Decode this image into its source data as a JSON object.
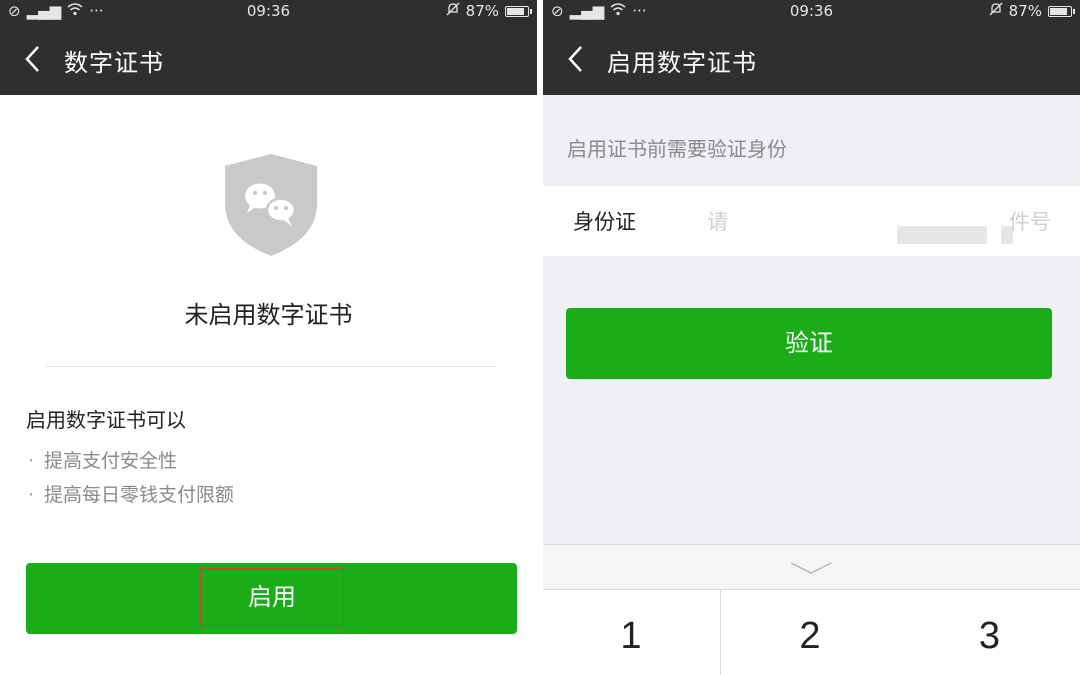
{
  "status_bar": {
    "time": "09:36",
    "battery": "87%",
    "battery_level": 0.87,
    "left_icons": [
      "no-sim-icon",
      "signal-icon",
      "wifi-icon",
      "more-dots-icon"
    ],
    "right_icons": [
      "mute-bell-icon",
      "battery-icon"
    ]
  },
  "left_screen": {
    "nav_title": "数字证书",
    "shield_icon": "wechat-shield-icon",
    "status_title": "未启用数字证书",
    "benefits_heading": "启用数字证书可以",
    "benefits": [
      "提高支付安全性",
      "提高每日零钱支付限额"
    ],
    "enable_button": "启用",
    "colors": {
      "primary_green": "#1aad19",
      "highlight_box": "#c1472f"
    }
  },
  "right_screen": {
    "nav_title": "启用数字证书",
    "hint": "启用证书前需要验证身份",
    "id_label": "身份证",
    "id_placeholder_start": "请",
    "id_placeholder_end": "件号",
    "verify_button": "验证",
    "keyboard": {
      "collapse_icon": "chevron-down-icon",
      "keys": [
        "1",
        "2",
        "3"
      ]
    }
  }
}
